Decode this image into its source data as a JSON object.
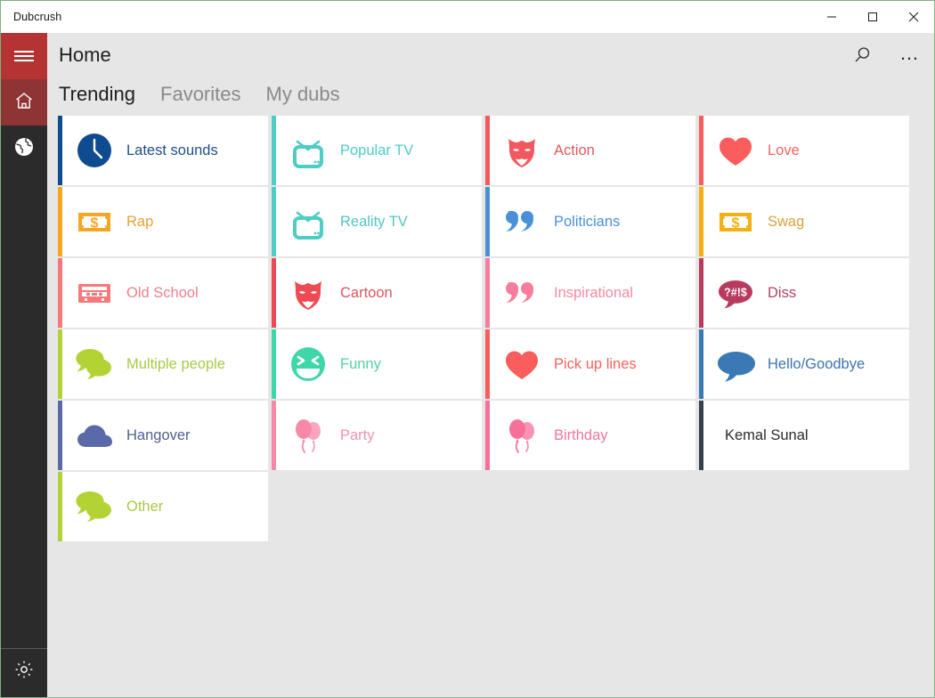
{
  "window": {
    "title": "Dubcrush",
    "controls": [
      {
        "name": "minimize-button",
        "glyph": "minimize"
      },
      {
        "name": "maximize-button",
        "glyph": "maximize"
      },
      {
        "name": "close-button",
        "glyph": "close"
      }
    ]
  },
  "rail": {
    "items": [
      {
        "name": "hamburger-menu-button",
        "icon": "hamburger-icon",
        "label": "Menu"
      },
      {
        "name": "home-button",
        "icon": "home-icon",
        "label": "Home",
        "selected": true
      },
      {
        "name": "globe-button",
        "icon": "globe-icon",
        "label": "Explore"
      }
    ],
    "settings": {
      "name": "settings-button",
      "icon": "gear-icon",
      "label": "Settings"
    }
  },
  "header": {
    "title": "Home",
    "search_label": "Search",
    "more_label": "More options"
  },
  "tabs": [
    {
      "label": "Trending",
      "active": true
    },
    {
      "label": "Favorites",
      "active": false
    },
    {
      "label": "My dubs",
      "active": false
    }
  ],
  "tiles": [
    {
      "label": "Latest sounds",
      "icon": "clock-icon",
      "color": "#0f4b8f",
      "text_color": "#1c4f86"
    },
    {
      "label": "Popular TV",
      "icon": "television-icon",
      "color": "#4ecdc4",
      "text_color": "#4ecdc4"
    },
    {
      "label": "Action",
      "icon": "mask-icon",
      "color": "#f1585f",
      "text_color": "#e0585f"
    },
    {
      "label": "Love",
      "icon": "heart-icon",
      "color": "#fb5c5c",
      "text_color": "#f4635f"
    },
    {
      "label": "Rap",
      "icon": "banknote-icon",
      "color": "#f5a623",
      "text_color": "#e8a033"
    },
    {
      "label": "Reality TV",
      "icon": "television-icon",
      "color": "#4ecdc4",
      "text_color": "#50c6c0"
    },
    {
      "label": "Politicians",
      "icon": "quote-icon",
      "color": "#4a90d9",
      "text_color": "#4a90d9"
    },
    {
      "label": "Swag",
      "icon": "banknote-icon",
      "color": "#f5b014",
      "text_color": "#d8a33b"
    },
    {
      "label": "Old School",
      "icon": "cassette-icon",
      "color": "#f4787c",
      "text_color": "#ef8287"
    },
    {
      "label": "Cartoon",
      "icon": "mask-icon",
      "color": "#ef4a53",
      "text_color": "#d9565d"
    },
    {
      "label": "Inspirational",
      "icon": "quote-icon",
      "color": "#f77d9c",
      "text_color": "#f58aa3"
    },
    {
      "label": "Diss",
      "icon": "censored-bubble-icon",
      "color": "#b83b5e",
      "text_color": "#b2455f"
    },
    {
      "label": "Multiple people",
      "icon": "chat-bubbles-icon",
      "color": "#b3d334",
      "text_color": "#aac944"
    },
    {
      "label": "Funny",
      "icon": "laughing-face-icon",
      "color": "#3fd6a8",
      "text_color": "#52cfa8"
    },
    {
      "label": "Pick up lines",
      "icon": "heart-icon",
      "color": "#fb5c5c",
      "text_color": "#f4635f"
    },
    {
      "label": "Hello/Goodbye",
      "icon": "speech-bubble-icon",
      "color": "#3a79b4",
      "text_color": "#3c74ae"
    },
    {
      "label": "Hangover",
      "icon": "cloud-icon",
      "color": "#5a6aa8",
      "text_color": "#4e5f91"
    },
    {
      "label": "Party",
      "icon": "balloons-icon",
      "color": "#f788a8",
      "text_color": "#f58fae"
    },
    {
      "label": "Birthday",
      "icon": "balloons-icon",
      "color": "#f7709a",
      "text_color": "#f4749c"
    },
    {
      "label": "Kemal Sunal",
      "icon": "none",
      "color": "#36404d",
      "text_color": "#2b2b2b"
    },
    {
      "label": "Other",
      "icon": "chat-bubbles-icon",
      "color": "#b3d334",
      "text_color": "#aac944"
    }
  ]
}
